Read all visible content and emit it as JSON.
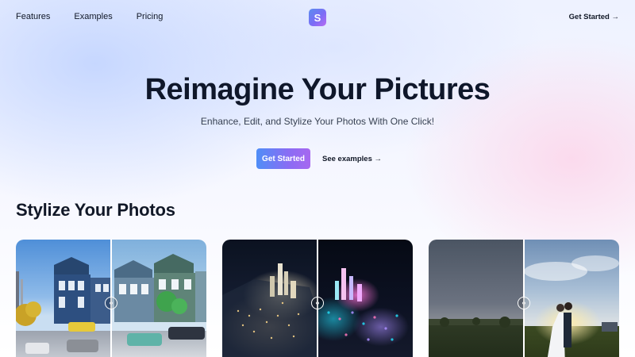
{
  "nav": {
    "links": [
      "Features",
      "Examples",
      "Pricing"
    ],
    "logo_letter": "S",
    "cta": "Get Started →"
  },
  "hero": {
    "title": "Reimagine Your Pictures",
    "subtitle": "Enhance, Edit, and Stylize Your Photos With One Click!",
    "primary_button": "Get Started",
    "secondary_link": "See examples →"
  },
  "section": {
    "title": "Stylize Your Photos"
  },
  "cards": [
    {
      "subject": "street-houses",
      "handle_glyph": "‹›"
    },
    {
      "subject": "city-night",
      "handle_glyph": "‹›"
    },
    {
      "subject": "couple-sunset",
      "handle_glyph": "‹›"
    }
  ],
  "colors": {
    "accent_start": "#4f8ef7",
    "accent_end": "#a768f0",
    "text": "#111827"
  }
}
